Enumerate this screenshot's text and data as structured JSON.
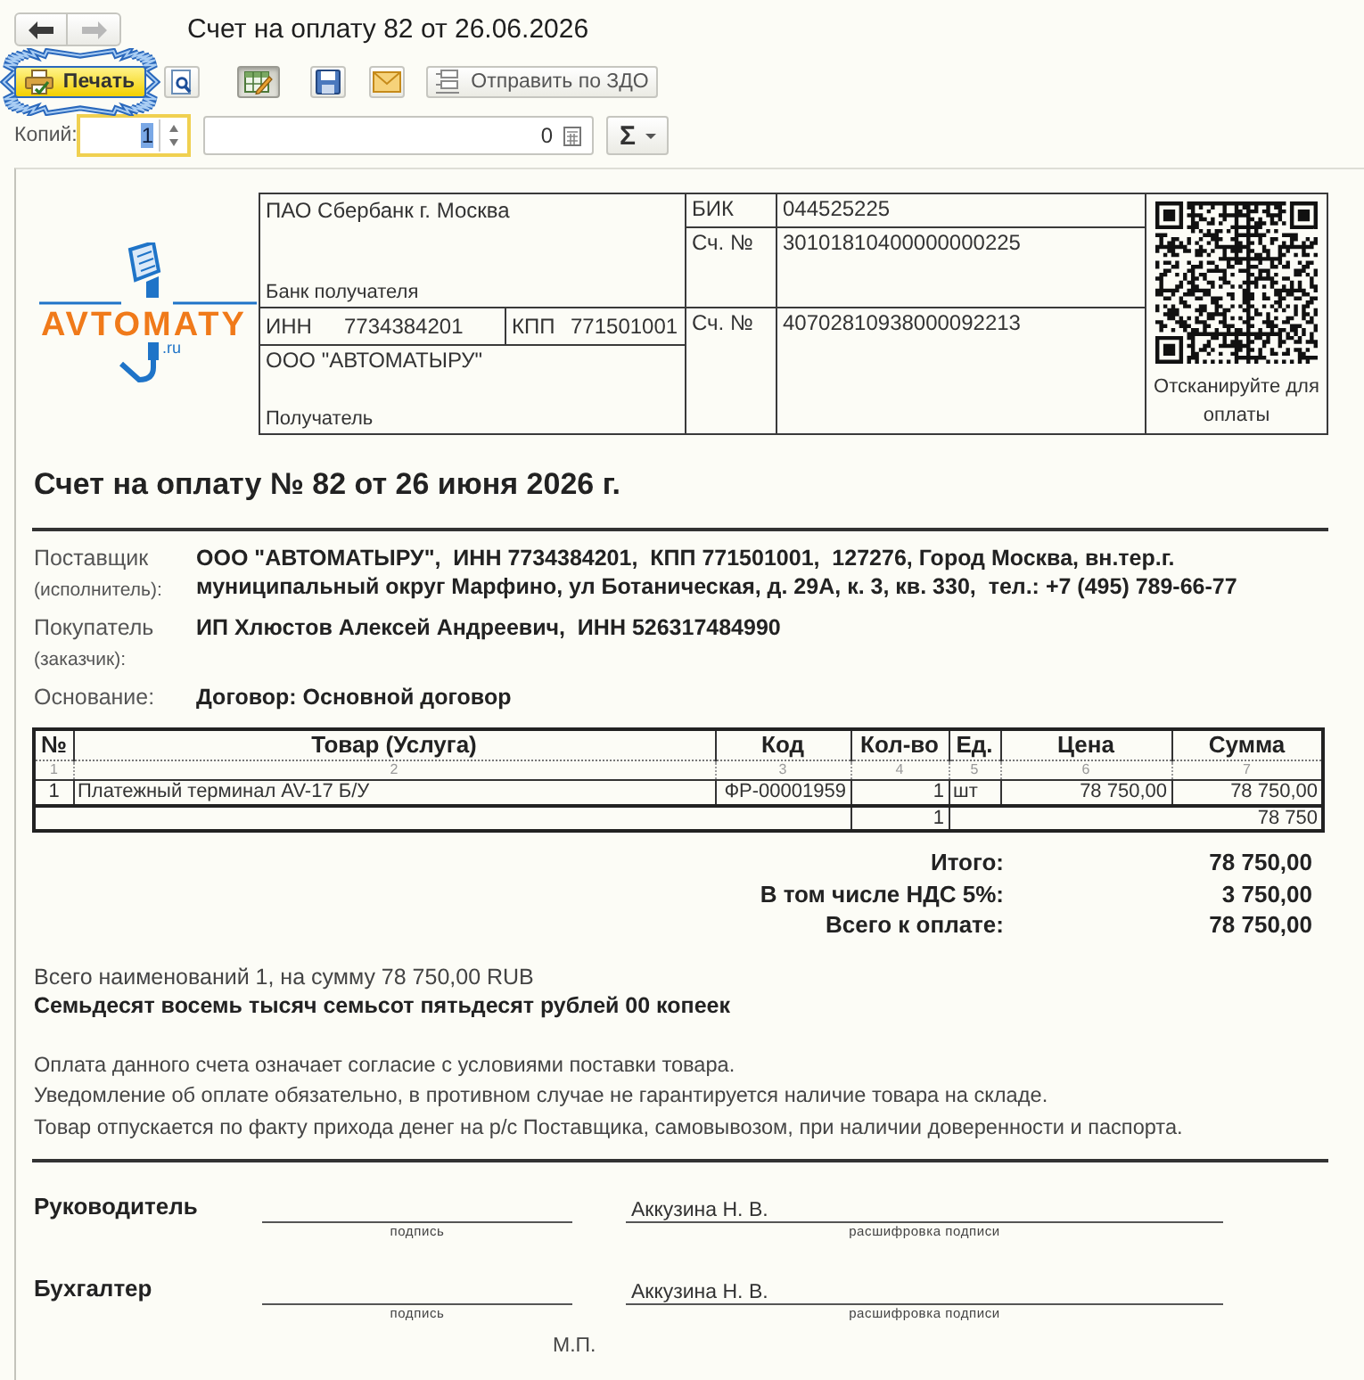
{
  "window": {
    "title": "Счет на оплату 82 от 26.06.2026"
  },
  "nav_buttons": [
    {
      "kind": "back",
      "disabled": false
    },
    {
      "kind": "forward",
      "disabled": true
    }
  ],
  "toolbar": {
    "buttons": [
      {
        "kind": "print",
        "label": "Печать",
        "pressed": false,
        "highlighted": true
      },
      {
        "kind": "preview",
        "pressed": false,
        "highlighted": false
      },
      {
        "kind": "edit",
        "pressed": true,
        "highlighted": false
      },
      {
        "kind": "save",
        "pressed": false,
        "highlighted": false
      },
      {
        "kind": "mail",
        "pressed": false,
        "highlighted": false
      },
      {
        "kind": "send",
        "label": "Отправить по ЗДО",
        "pressed": false,
        "highlighted": false
      }
    ]
  },
  "copies": {
    "label": "Копий:",
    "value": "1",
    "focused": true
  },
  "number_field": {
    "value": "0"
  },
  "sum_button": {
    "label": "Σ"
  },
  "logo": {
    "text": "AVTOMATY",
    "suffix": ".ru"
  },
  "bank_details": {
    "bank_name": "ПАО Сбербанк г. Москва",
    "bank_caption": "Банк получателя",
    "bik_label": "БИК",
    "bik": "044525225",
    "corr_account_label": "Сч. №",
    "corr_account": "30101810400000000225",
    "inn_label": "ИНН",
    "inn": "7734384201",
    "kpp_label": "КПП",
    "kpp": "771501001",
    "account_label": "Сч. №",
    "account": "40702810938000092213",
    "recipient": "ООО \"АВТОМАТЫРУ\"",
    "recipient_caption": "Получатель",
    "qr_caption": "Отсканируйте для оплаты"
  },
  "invoice_title": "Счет на оплату № 82 от 26 июня 2026 г.",
  "parties": [
    {
      "label": "Поставщик",
      "sublabel": "(исполнитель):",
      "value": "ООО \"АВТОМАТЫРУ\",  ИНН 7734384201,  КПП 771501001,  127276, Город Москва, вн.тер.г. муниципальный округ Марфино, ул Ботаническая, д. 29А, к. 3, кв. 330,  тел.: +7 (495) 789-66-77"
    },
    {
      "label": "Покупатель",
      "sublabel": "(заказчик):",
      "value": "ИП Хлюстов Алексей Андреевич,  ИНН 526317484990"
    },
    {
      "label": "Основание:",
      "value": "Договор: Основной договор"
    }
  ],
  "items_table": {
    "columns": [
      {
        "title": "№",
        "number": "1"
      },
      {
        "title": "Товар (Услуга)",
        "number": "2"
      },
      {
        "title": "Код",
        "number": "3"
      },
      {
        "title": "Кол-во",
        "number": "4"
      },
      {
        "title": "Ед.",
        "number": "5"
      },
      {
        "title": "Цена",
        "number": "6"
      },
      {
        "title": "Сумма",
        "number": "7"
      }
    ],
    "rows": [
      [
        "1",
        "Платежный терминал AV-17 Б/У",
        "ФР-00001959",
        "1",
        "шт",
        "78 750,00",
        "78 750,00"
      ]
    ],
    "total_row": {
      "quantity": "1",
      "sum": "78 750"
    }
  },
  "totals": [
    {
      "label": "Итого:",
      "value": "78 750,00"
    },
    {
      "label": "В том числе НДС 5%:",
      "value": "3 750,00"
    },
    {
      "label": "Всего к оплате:",
      "value": "78 750,00"
    }
  ],
  "summary": {
    "count_line": "Всего наименований 1, на сумму 78 750,00 RUB",
    "amount_in_words": "Семьдесят восемь тысяч семьсот пятьдесят рублей 00 копеек"
  },
  "notes": [
    "Оплата данного счета означает согласие с условиями поставки товара.",
    "Уведомление об оплате обязательно, в противном случае не гарантируется наличие товара на складе.",
    "Товар отпускается по факту прихода денег на р/с Поставщика, самовывозом, при наличии доверенности и паспорта."
  ],
  "signatures": [
    {
      "role": "Руководитель",
      "signature_caption": "подпись",
      "name": "Аккузина Н. В.",
      "name_caption": "расшифровка подписи"
    },
    {
      "role": "Бухгалтер",
      "signature_caption": "подпись",
      "name": "Аккузина Н. В.",
      "name_caption": "расшифровка подписи"
    }
  ],
  "stamp": "М.П."
}
